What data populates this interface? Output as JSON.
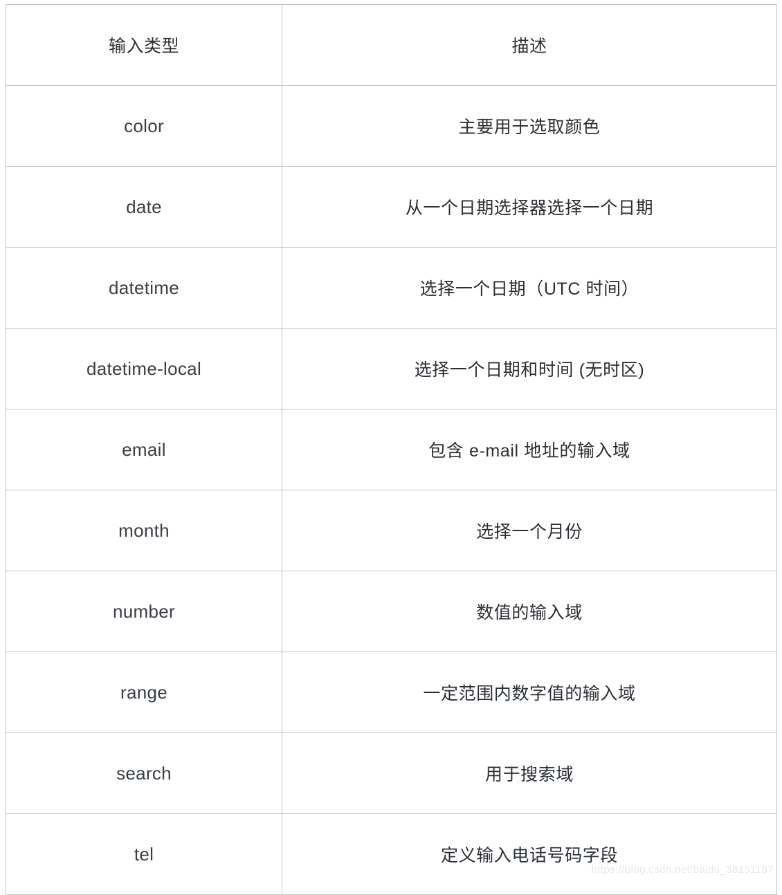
{
  "table": {
    "headers": {
      "type": "输入类型",
      "description": "描述"
    },
    "rows": [
      {
        "type": "color",
        "description": "主要用于选取颜色"
      },
      {
        "type": "date",
        "description": "从一个日期选择器选择一个日期"
      },
      {
        "type": "datetime",
        "description": "选择一个日期（UTC 时间）"
      },
      {
        "type": "datetime-local",
        "description": "选择一个日期和时间 (无时区)"
      },
      {
        "type": "email",
        "description": "包含 e-mail 地址的输入域"
      },
      {
        "type": "month",
        "description": "选择一个月份"
      },
      {
        "type": "number",
        "description": "数值的输入域"
      },
      {
        "type": "range",
        "description": "一定范围内数字值的输入域"
      },
      {
        "type": "search",
        "description": "用于搜索域"
      },
      {
        "type": "tel",
        "description": "定义输入电话号码字段"
      }
    ]
  },
  "watermark": {
    "text": "https://blog.csdn.net/baidu_38151187"
  },
  "colors": {
    "border": "#c3c3c3",
    "text": "#2b2f34",
    "background": "#ffffff",
    "watermark": "#e8e8e8"
  }
}
